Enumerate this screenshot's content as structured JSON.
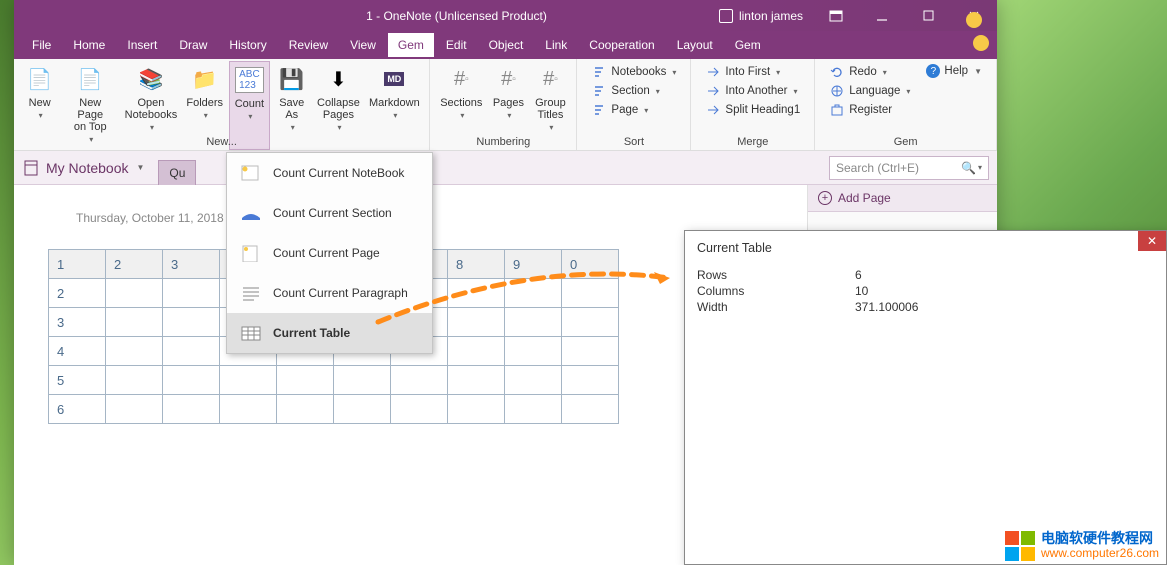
{
  "title": "1  -  OneNote (Unlicensed Product)",
  "user": "linton james",
  "menu": [
    "File",
    "Home",
    "Insert",
    "Draw",
    "History",
    "Review",
    "View",
    "Gem",
    "Edit",
    "Object",
    "Link",
    "Cooperation",
    "Layout",
    "Gem"
  ],
  "menu_active": 7,
  "ribbon": {
    "new_group": {
      "label": "New...",
      "items": [
        {
          "t": "New"
        },
        {
          "t": "New Page\non Top"
        },
        {
          "t": "Open\nNotebooks"
        },
        {
          "t": "Folders"
        },
        {
          "t": "Count"
        },
        {
          "t": "Save\nAs"
        },
        {
          "t": "Collapse\nPages"
        },
        {
          "t": "Markdown"
        }
      ]
    },
    "numbering": {
      "label": "Numbering",
      "items": [
        {
          "t": "Sections"
        },
        {
          "t": "Pages"
        },
        {
          "t": "Group\nTitles"
        }
      ]
    },
    "sort": {
      "label": "Sort",
      "rows": [
        "Notebooks",
        "Section",
        "Page"
      ]
    },
    "merge": {
      "label": "Merge",
      "rows": [
        "Into First",
        "Into Another",
        "Split Heading1"
      ]
    },
    "gem": {
      "label": "Gem",
      "rows": [
        "Redo",
        "Language",
        "Register"
      ],
      "help": "Help"
    }
  },
  "dropdown": [
    {
      "label": "Count Current NoteBook"
    },
    {
      "label": "Count Current Section"
    },
    {
      "label": "Count Current Page"
    },
    {
      "label": "Count Current Paragraph"
    },
    {
      "label": "Current Table",
      "sel": true
    }
  ],
  "notebook": "My Notebook",
  "tab": "Qu",
  "search_ph": "Search (Ctrl+E)",
  "addpage": "Add Page",
  "date": "Thursday, October 11, 2018",
  "table_header": [
    "1",
    "2",
    "3",
    "",
    "",
    "",
    "",
    "8",
    "9",
    "0"
  ],
  "table_rows": [
    "2",
    "3",
    "4",
    "5",
    "6"
  ],
  "popup": {
    "title": "Current Table",
    "rows": [
      [
        "Rows",
        "6"
      ],
      [
        "Columns",
        "10"
      ],
      [
        "Width",
        "371.100006"
      ]
    ],
    "close": "✕"
  },
  "watermark": {
    "line1": "电脑软硬件教程网",
    "line2": "www.computer26.com"
  }
}
